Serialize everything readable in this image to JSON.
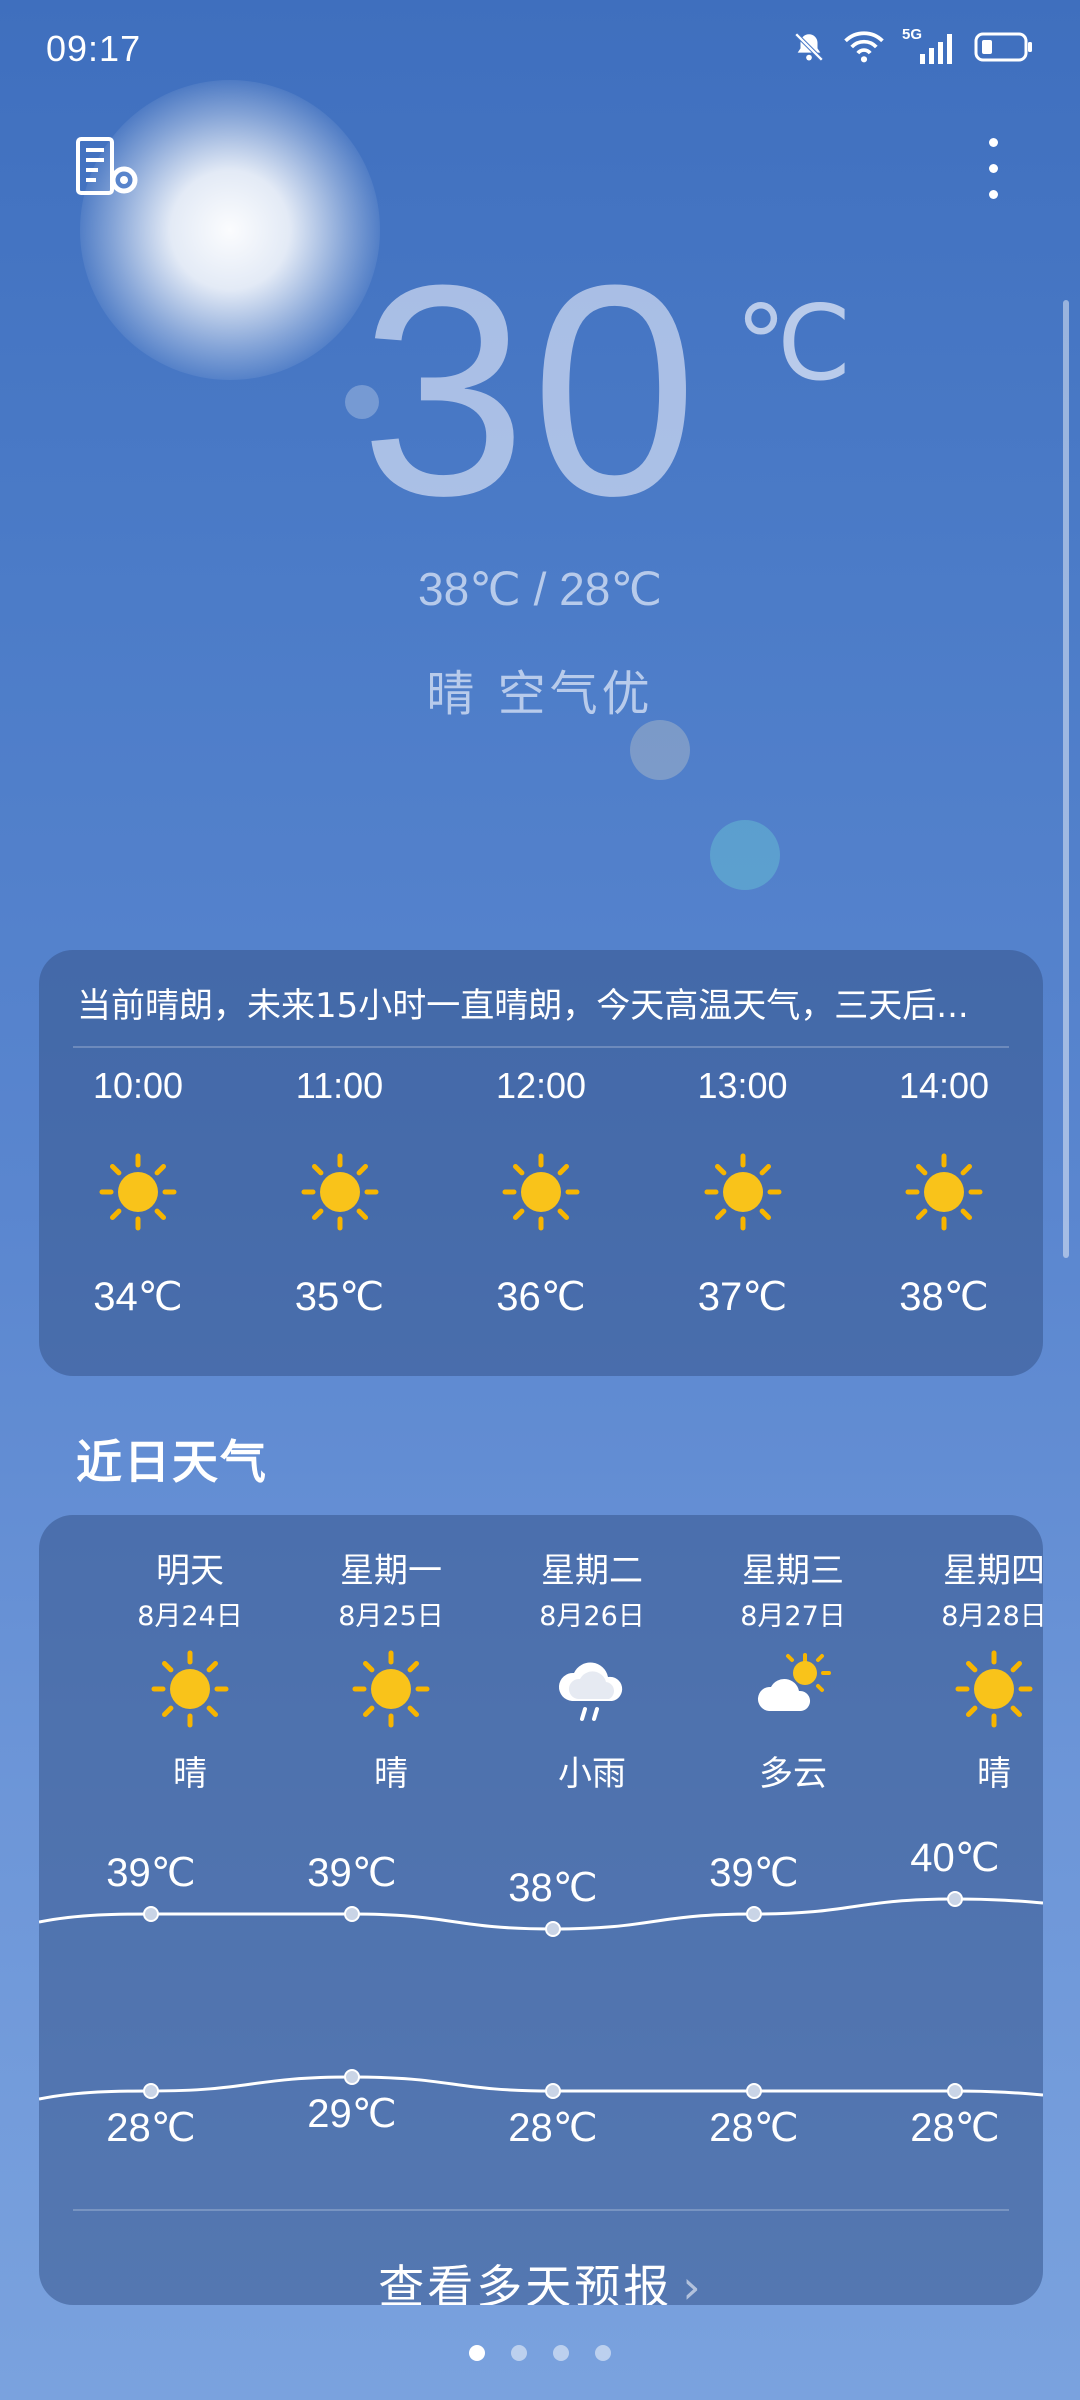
{
  "status_bar": {
    "time": "09:17",
    "network": "5G"
  },
  "current": {
    "temp": "30",
    "unit": "℃",
    "hi_lo": "38℃ / 28℃",
    "condition": "晴  空气优"
  },
  "hourly_card": {
    "summary": "当前晴朗，未来15小时一直晴朗，今天高温天气，三天后...",
    "hours": [
      {
        "time": "10:00",
        "icon": "sunny-icon",
        "temp": "34℃"
      },
      {
        "time": "11:00",
        "icon": "sunny-icon",
        "temp": "35℃"
      },
      {
        "time": "12:00",
        "icon": "sunny-icon",
        "temp": "36℃"
      },
      {
        "time": "13:00",
        "icon": "sunny-icon",
        "temp": "37℃"
      },
      {
        "time": "14:00",
        "icon": "sunny-icon",
        "temp": "38℃"
      }
    ]
  },
  "recent": {
    "title": "近日天气",
    "days": [
      {
        "name": "明天",
        "date": "8月24日",
        "icon": "sunny-icon",
        "condition": "晴",
        "high": "39℃",
        "low": "28℃",
        "high_value": 39,
        "low_value": 28
      },
      {
        "name": "星期一",
        "date": "8月25日",
        "icon": "sunny-icon",
        "condition": "晴",
        "high": "39℃",
        "low": "29℃",
        "high_value": 39,
        "low_value": 29
      },
      {
        "name": "星期二",
        "date": "8月26日",
        "icon": "light-rain-icon",
        "condition": "小雨",
        "high": "38℃",
        "low": "28℃",
        "high_value": 38,
        "low_value": 28
      },
      {
        "name": "星期三",
        "date": "8月27日",
        "icon": "partly-cloudy-icon",
        "condition": "多云",
        "high": "39℃",
        "low": "28℃",
        "high_value": 39,
        "low_value": 28
      },
      {
        "name": "星期四",
        "date": "8月28日",
        "icon": "sunny-icon",
        "condition": "晴",
        "high": "40℃",
        "low": "28℃",
        "high_value": 40,
        "low_value": 28
      }
    ],
    "more_label": "查看多天预报"
  },
  "pager": {
    "count": 4,
    "active": 0
  },
  "colors": {
    "accent_sun": "#f9c31a",
    "sun_ray": "#f7b500"
  }
}
